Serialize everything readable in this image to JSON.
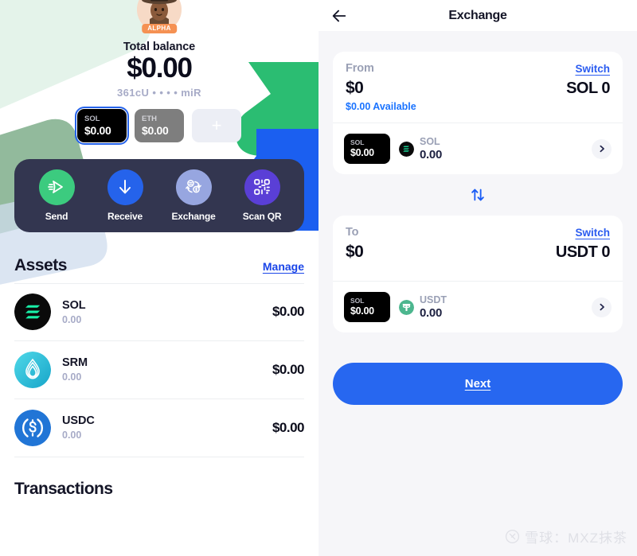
{
  "left": {
    "avatar": {
      "name": "user-avatar",
      "badge": "ALPHA"
    },
    "balance": {
      "label": "Total balance",
      "amount": "$0.00",
      "address": "361cU • • • • miR"
    },
    "chips": [
      {
        "symbol": "SOL",
        "value": "$0.00",
        "state": "selected"
      },
      {
        "symbol": "ETH",
        "value": "$0.00",
        "state": "normal"
      },
      {
        "symbol": "+",
        "value": "",
        "state": "add"
      }
    ],
    "actions": [
      {
        "label": "Send",
        "icon": "send-icon",
        "color": "#3ccb7f"
      },
      {
        "label": "Receive",
        "icon": "download-icon",
        "color": "#2563eb"
      },
      {
        "label": "Exchange",
        "icon": "exchange-icon",
        "color": "#97a6e0"
      },
      {
        "label": "Scan QR",
        "icon": "qr-icon",
        "color": "#5a3fd6"
      }
    ],
    "assets_section": {
      "title": "Assets",
      "manage_label": "Manage",
      "rows": [
        {
          "symbol": "SOL",
          "qty": "0.00",
          "usd": "$0.00",
          "icon": "solana-icon"
        },
        {
          "symbol": "SRM",
          "qty": "0.00",
          "usd": "$0.00",
          "icon": "serum-icon"
        },
        {
          "symbol": "USDC",
          "qty": "0.00",
          "usd": "$0.00",
          "icon": "usdc-icon"
        }
      ]
    },
    "transactions_title": "Transactions"
  },
  "right": {
    "header": {
      "title": "Exchange",
      "back_icon": "arrow-left-icon"
    },
    "from_card": {
      "label": "From",
      "switch_label": "Switch",
      "amount": "$0",
      "token_amount": "SOL 0",
      "available": "$0.00 Available",
      "selector": {
        "chip_symbol": "SOL",
        "chip_value": "$0.00",
        "token_name": "SOL",
        "token_qty": "0.00",
        "chevron_icon": "chevron-right-icon"
      }
    },
    "swap_icon": "swap-vertical-icon",
    "to_card": {
      "label": "To",
      "switch_label": "Switch",
      "amount": "$0",
      "token_amount": "USDT 0",
      "selector": {
        "chip_symbol": "SOL",
        "chip_value": "$0.00",
        "token_name": "USDT",
        "token_qty": "0.00",
        "chevron_icon": "chevron-right-icon"
      }
    },
    "next_label": "Next",
    "watermark": "雪球：MXZ抹茶"
  },
  "colors": {
    "accent_blue": "#2767f0",
    "link_blue": "#1a45e8",
    "green": "#3ccb7f",
    "dark_card": "#333650",
    "panel_bg": "#f6f6f9"
  }
}
